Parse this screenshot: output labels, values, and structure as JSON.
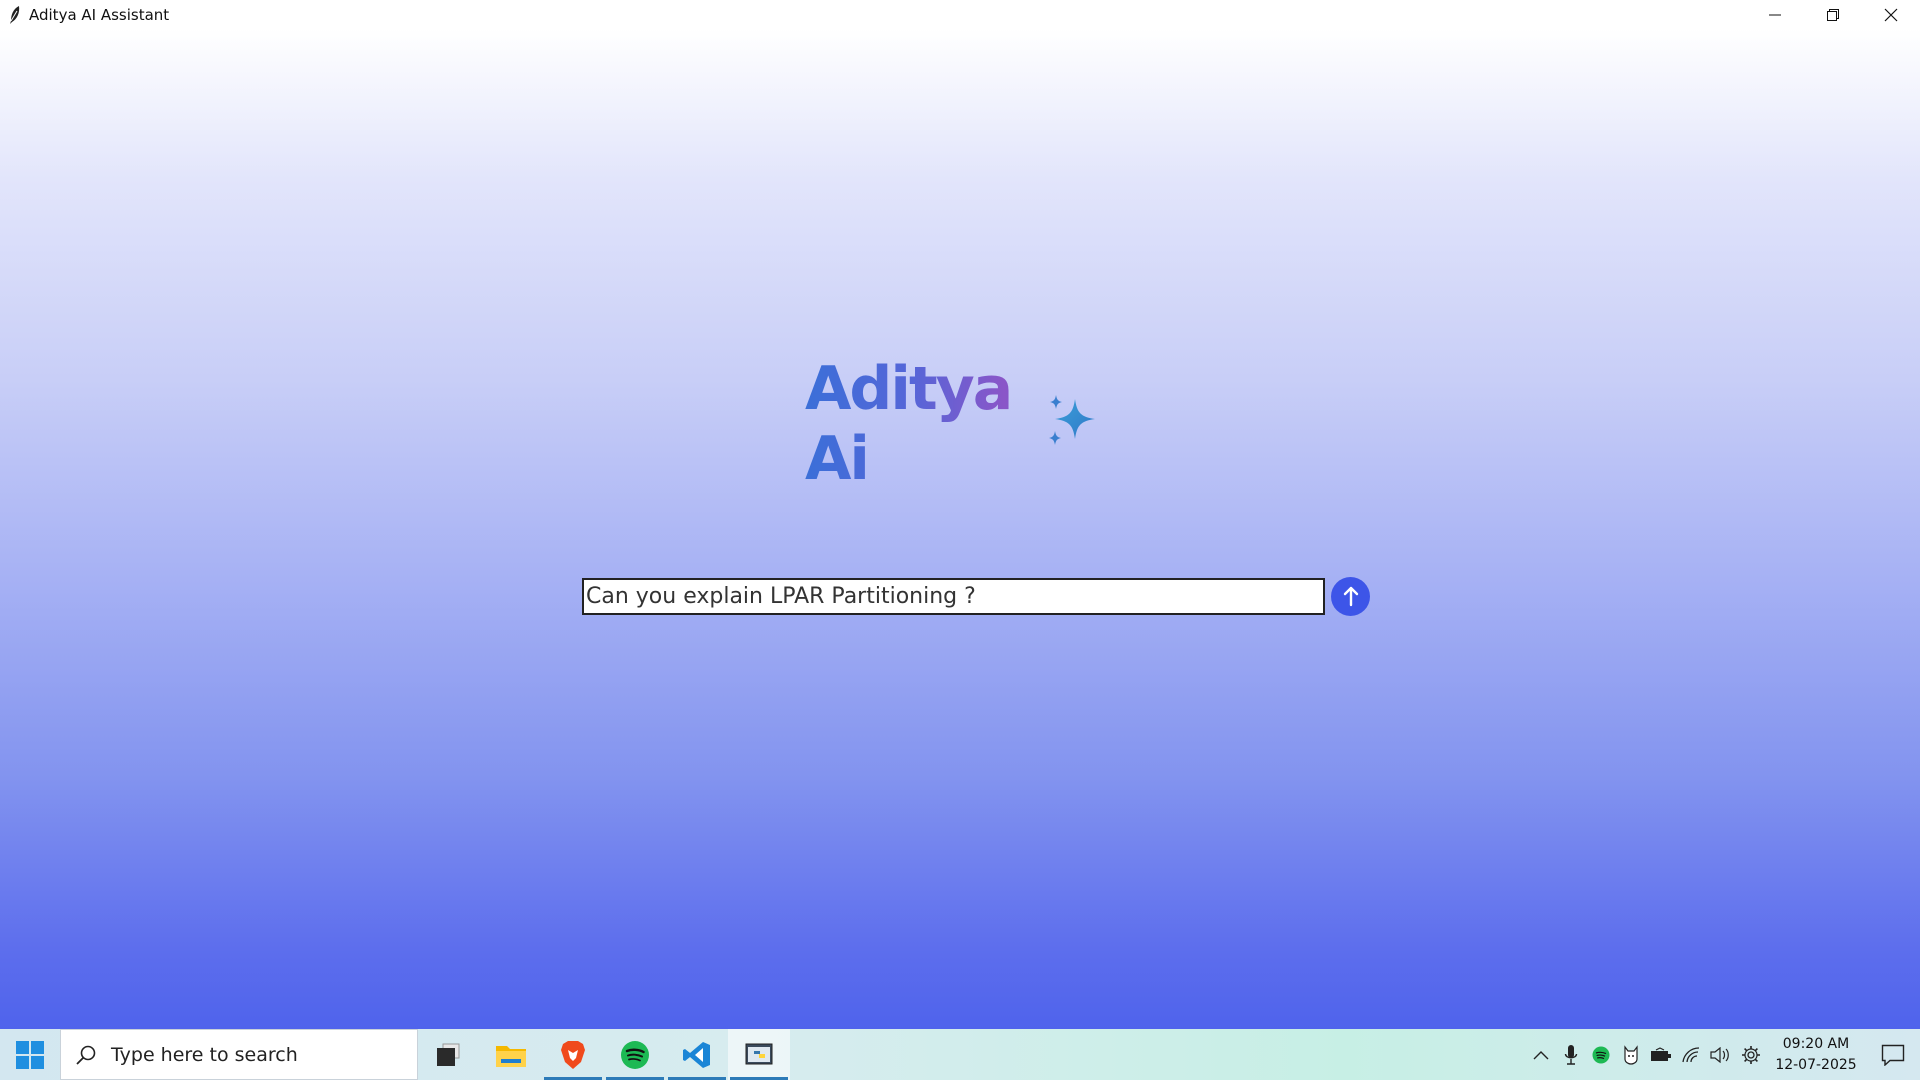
{
  "window": {
    "title": "Aditya AI Assistant",
    "controls": [
      "minimize",
      "restore",
      "close"
    ]
  },
  "main": {
    "logo_text": "Aditya Ai",
    "prompt_value": "Can you explain LPAR Partitioning ?",
    "send_icon": "arrow-up-icon"
  },
  "colors": {
    "accent": "#3d55e8",
    "gradient_top": "#ffffff",
    "gradient_bottom": "#4f63ec"
  },
  "taskbar": {
    "search_placeholder": "Type here to search",
    "apps": [
      "task-view",
      "file-explorer",
      "brave",
      "spotify",
      "vscode",
      "python"
    ],
    "tray_icons": [
      "chevron-up",
      "microphone",
      "spotify",
      "cat",
      "battery",
      "wifi",
      "speaker",
      "settings"
    ],
    "time": "09:20 AM",
    "date": "12-07-2025"
  }
}
